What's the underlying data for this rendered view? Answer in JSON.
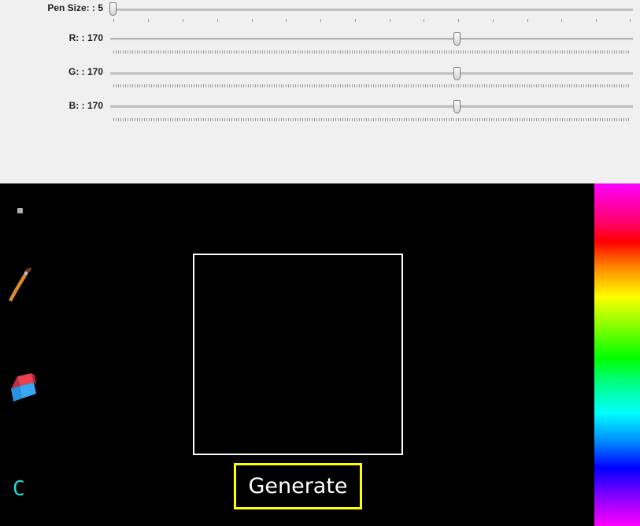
{
  "sliders": [
    {
      "label": "Pen Size: : 5",
      "value": 5,
      "min": 0,
      "max": 100
    },
    {
      "label": "R: : 170",
      "value": 170,
      "min": 0,
      "max": 255
    },
    {
      "label": "G: : 170",
      "value": 170,
      "min": 0,
      "max": 255
    },
    {
      "label": "B: : 170",
      "value": 170,
      "min": 0,
      "max": 255
    }
  ],
  "tools": {
    "pen_preview": "pen-size-dot",
    "brush": "paintbrush-icon",
    "eraser": "eraser-icon",
    "clear": "C"
  },
  "generate_label": "Generate",
  "colors": {
    "panel_bg": "#f0f0f0",
    "canvas_bg": "#000000",
    "box_border": "#ffffff",
    "button_border": "#ffff00",
    "clear_color": "#22d8d8"
  }
}
